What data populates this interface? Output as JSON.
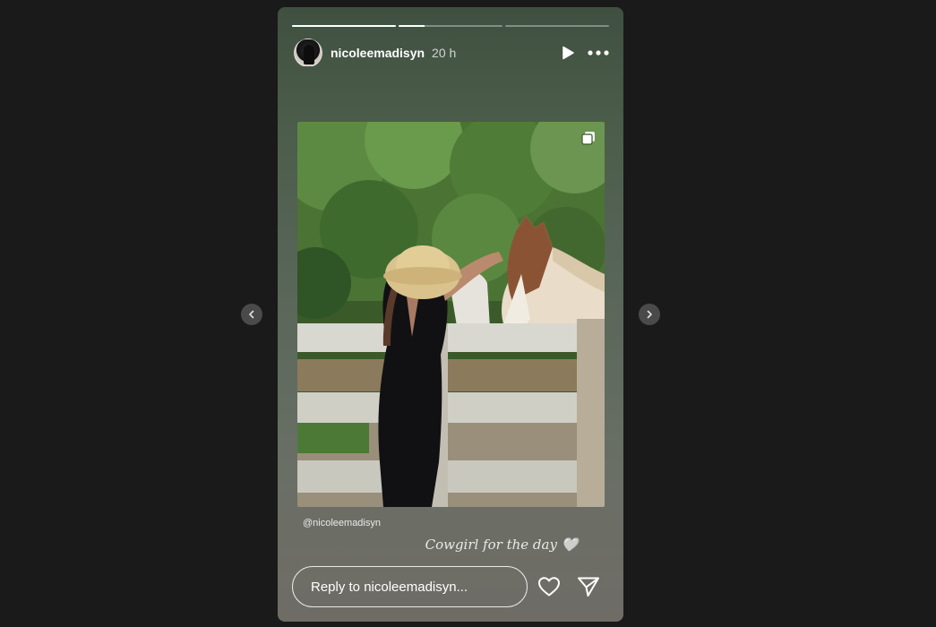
{
  "story": {
    "username": "nicoleemadisyn",
    "time_ago": "20 h",
    "progress": [
      1.0,
      0.25,
      0.0
    ],
    "mention": "@nicoleemadisyn",
    "caption": "Cowgirl for the day 🤍",
    "reply_placeholder": "Reply to nicoleemadisyn..."
  },
  "icons": {
    "play": "play-icon",
    "more": "more-icon",
    "multi": "multiple-photos-icon",
    "like": "heart-icon",
    "share": "send-icon",
    "prev": "chevron-left-icon",
    "next": "chevron-right-icon"
  },
  "colors": {
    "background": "#1a1a1a",
    "story_top": "#3f5040",
    "story_bottom": "#6f6c66",
    "text": "#ffffff"
  }
}
